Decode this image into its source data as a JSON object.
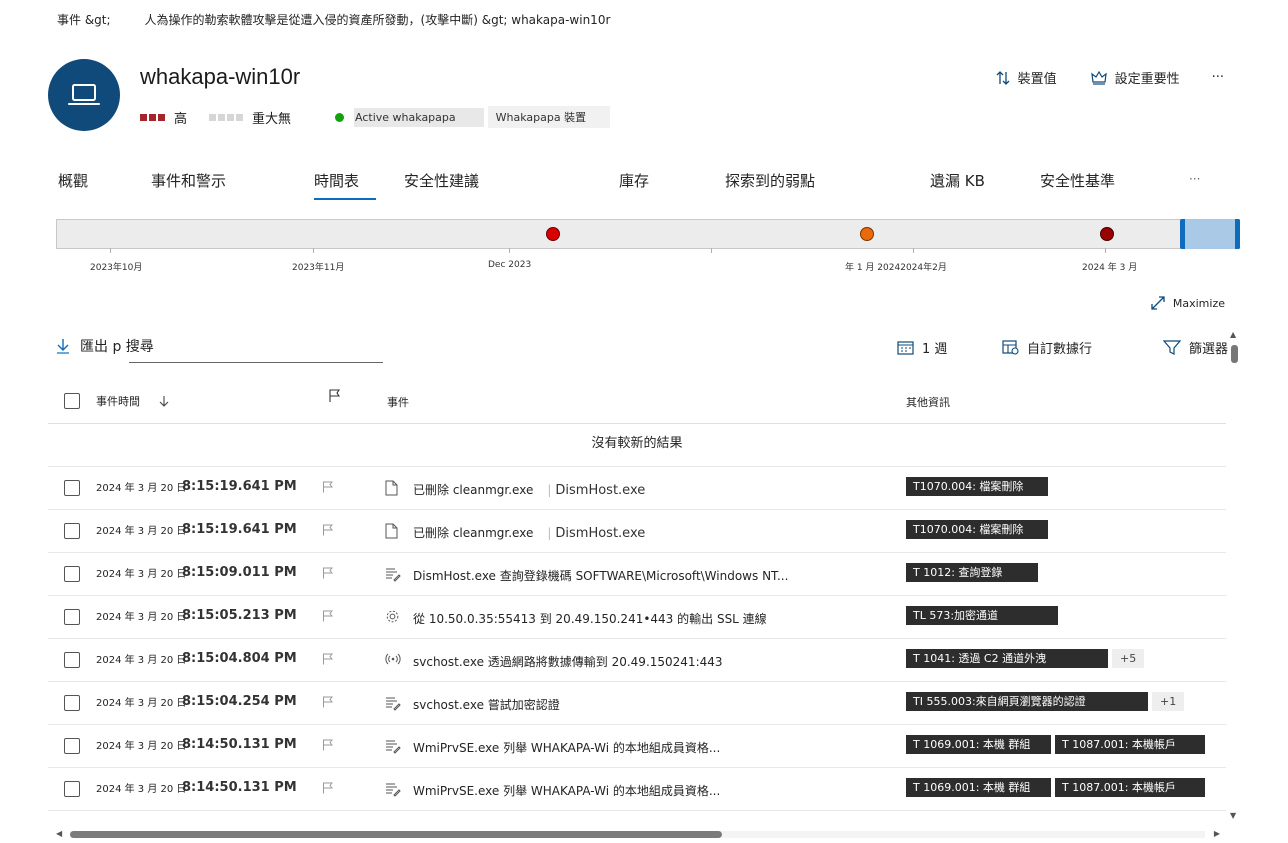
{
  "breadcrumb": {
    "root": "事件 &gt;",
    "path": "人為操作的勒索軟體攻擊是從遭入侵的資產所發動，(攻擊中斷) &gt; whakapa-win10r"
  },
  "device": {
    "name": "whakapa-win10r",
    "risk_label": "高",
    "criticality_label": "重大無",
    "active_tag": "Active whakapapa",
    "device_tag": "Whakapapa 裝置",
    "icon": "laptop-icon"
  },
  "header_actions": {
    "device_value": "裝置值",
    "set_criticality": "設定重要性",
    "more": "···"
  },
  "tabs": [
    {
      "label": "概觀"
    },
    {
      "label": "事件和警示"
    },
    {
      "label": "時間表"
    },
    {
      "label": "安全性建議"
    },
    {
      "label": "庫存"
    },
    {
      "label": "探索到的弱點"
    },
    {
      "label": "遺漏 KB"
    },
    {
      "label": "安全性基準"
    },
    {
      "label": "···"
    }
  ],
  "timeline": {
    "labels": [
      "2023年10月",
      "2023年11月",
      "Dec 2023",
      "年 1 月 20242024年2月",
      "2024 年 3 月"
    ],
    "event_colors": [
      "#d90000",
      "#ea6a0a",
      "#9a0000"
    ]
  },
  "maximize_label": "Maximize",
  "toolbar": {
    "export_search": "匯出 p 搜尋",
    "range": "1 週",
    "custom_columns": "自訂數據行",
    "filter": "篩選器"
  },
  "columns": {
    "time": "事件時間",
    "event": "事件",
    "other": "其他資訊"
  },
  "no_newer": "沒有較新的結果",
  "rows": [
    {
      "date": "2024 年 3 月 20 日",
      "time": "8:15:19.641 PM",
      "icon": "file-icon",
      "event": "已刪除 cleanmgr.exe",
      "host": "DismHost.exe",
      "tags": [
        "T1070.004: 檔案刪除"
      ],
      "extra": ""
    },
    {
      "date": "2024 年 3 月 20 日",
      "time": "8:15:19.641 PM",
      "icon": "file-icon",
      "event": "已刪除 cleanmgr.exe",
      "host": "DismHost.exe",
      "tags": [
        "T1070.004: 檔案刪除"
      ],
      "extra": ""
    },
    {
      "date": "2024 年 3 月 20 日",
      "time": "8:15:09.011 PM",
      "icon": "registry-icon",
      "event": "DismHost.exe 查詢登錄機碼 SOFTWARE\\Microsoft\\Windows NT...",
      "host": "",
      "tags": [
        "T 1012: 查詢登錄"
      ],
      "extra": ""
    },
    {
      "date": "2024 年 3 月 20 日",
      "time": "8:15:05.213 PM",
      "icon": "gear-icon",
      "event": "從 10.50.0.35:55413 到 20.49.150.241•443 的輸出 SSL 連線",
      "host": "",
      "tags": [
        "TL 573:加密通道"
      ],
      "extra": ""
    },
    {
      "date": "2024 年 3 月 20 日",
      "time": "8:15:04.804 PM",
      "icon": "network-icon",
      "event": "svchost.exe 透過網路將數據傳輸到 20.49.150241:443",
      "host": "",
      "tags": [
        "T 1041: 透過 C2 通道外洩"
      ],
      "extra": "+5"
    },
    {
      "date": "2024 年 3 月 20 日",
      "time": "8:15:04.254 PM",
      "icon": "registry-icon",
      "event": "svchost.exe 嘗試加密認證",
      "host": "",
      "tags": [
        "TI 555.003:來自網頁瀏覽器的認證"
      ],
      "extra": "+1"
    },
    {
      "date": "2024 年 3 月 20 日",
      "time": "8:14:50.131 PM",
      "icon": "registry-icon",
      "event": "WmiPrvSE.exe 列舉 WHAKAPA-Wi 的本地組成員資格...",
      "host": "",
      "tags": [
        "T 1069.001: 本機 群組",
        "T 1087.001: 本機帳戶"
      ],
      "extra": ""
    },
    {
      "date": "2024 年 3 月 20 日",
      "time": "8:14:50.131 PM",
      "icon": "registry-icon",
      "event": "WmiPrvSE.exe 列舉 WHAKAPA-Wi 的本地組成員資格...",
      "host": "",
      "tags": [
        "T 1069.001: 本機 群組",
        "T 1087.001: 本機帳戶"
      ],
      "extra": ""
    }
  ]
}
